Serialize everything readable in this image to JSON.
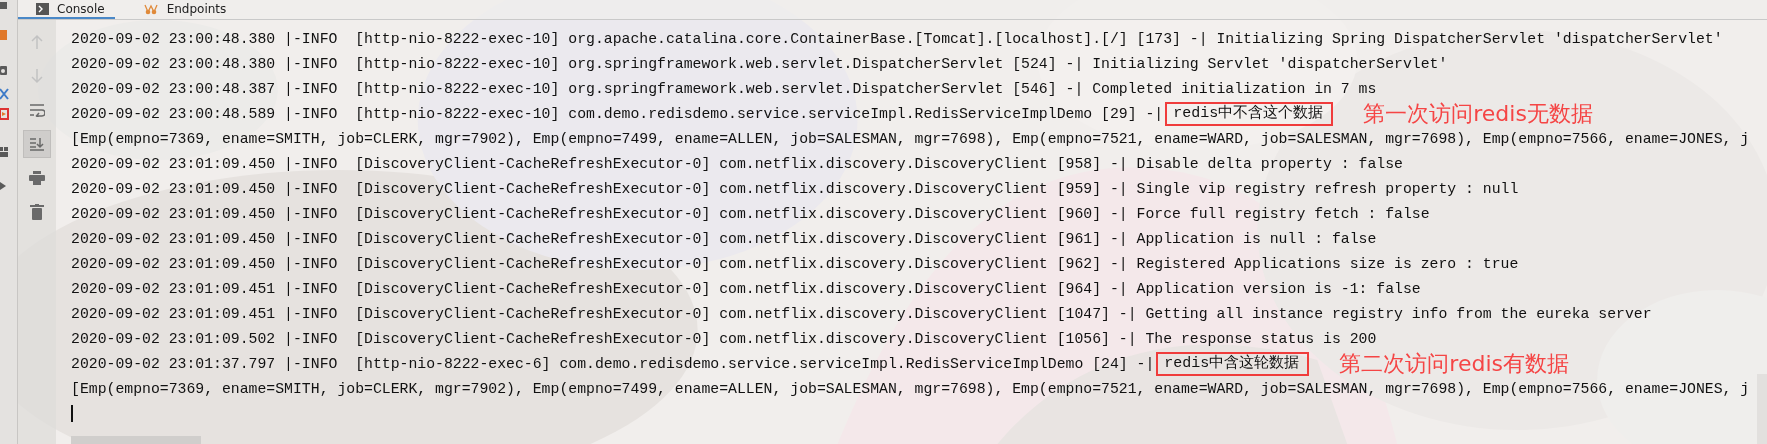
{
  "tabs": [
    {
      "label": "Console",
      "kind": "console",
      "selected": true
    },
    {
      "label": "Endpoints",
      "kind": "endpoints",
      "selected": false
    }
  ],
  "toolbar": [
    {
      "kind": "up",
      "disabled": true,
      "selected": false
    },
    {
      "kind": "down",
      "disabled": true,
      "selected": false
    },
    {
      "kind": "wrap",
      "disabled": false,
      "selected": false
    },
    {
      "kind": "scroll-end",
      "disabled": false,
      "selected": true
    },
    {
      "kind": "print",
      "disabled": false,
      "selected": false
    },
    {
      "kind": "trash",
      "disabled": false,
      "selected": false
    }
  ],
  "lines": [
    {
      "text": "2020-09-02 23:00:48.380 |-INFO  [http-nio-8222-exec-10] org.apache.catalina.core.ContainerBase.[Tomcat].[localhost].[/] [173] -| Initializing Spring DispatcherServlet 'dispatcherServlet'"
    },
    {
      "text": "2020-09-02 23:00:48.380 |-INFO  [http-nio-8222-exec-10] org.springframework.web.servlet.DispatcherServlet [524] -| Initializing Servlet 'dispatcherServlet'"
    },
    {
      "text": "2020-09-02 23:00:48.387 |-INFO  [http-nio-8222-exec-10] org.springframework.web.servlet.DispatcherServlet [546] -| Completed initialization in 7 ms"
    },
    {
      "text": "2020-09-02 23:00:48.589 |-INFO  [http-nio-8222-exec-10] com.demo.redisdemo.service.serviceImpl.RedisServiceImplDemo [29] -|",
      "highlight": "redis中不含这个数据",
      "annotation": "第一次访问redis无数据"
    },
    {
      "text": "[Emp(empno=7369, ename=SMITH, job=CLERK, mgr=7902), Emp(empno=7499, ename=ALLEN, job=SALESMAN, mgr=7698), Emp(empno=7521, ename=WARD, job=SALESMAN, mgr=7698), Emp(empno=7566, ename=JONES, j"
    },
    {
      "text": "2020-09-02 23:01:09.450 |-INFO  [DiscoveryClient-CacheRefreshExecutor-0] com.netflix.discovery.DiscoveryClient [958] -| Disable delta property : false"
    },
    {
      "text": "2020-09-02 23:01:09.450 |-INFO  [DiscoveryClient-CacheRefreshExecutor-0] com.netflix.discovery.DiscoveryClient [959] -| Single vip registry refresh property : null"
    },
    {
      "text": "2020-09-02 23:01:09.450 |-INFO  [DiscoveryClient-CacheRefreshExecutor-0] com.netflix.discovery.DiscoveryClient [960] -| Force full registry fetch : false"
    },
    {
      "text": "2020-09-02 23:01:09.450 |-INFO  [DiscoveryClient-CacheRefreshExecutor-0] com.netflix.discovery.DiscoveryClient [961] -| Application is null : false"
    },
    {
      "text": "2020-09-02 23:01:09.450 |-INFO  [DiscoveryClient-CacheRefreshExecutor-0] com.netflix.discovery.DiscoveryClient [962] -| Registered Applications size is zero : true"
    },
    {
      "text": "2020-09-02 23:01:09.451 |-INFO  [DiscoveryClient-CacheRefreshExecutor-0] com.netflix.discovery.DiscoveryClient [964] -| Application version is -1: false"
    },
    {
      "text": "2020-09-02 23:01:09.451 |-INFO  [DiscoveryClient-CacheRefreshExecutor-0] com.netflix.discovery.DiscoveryClient [1047] -| Getting all instance registry info from the eureka server"
    },
    {
      "text": "2020-09-02 23:01:09.502 |-INFO  [DiscoveryClient-CacheRefreshExecutor-0] com.netflix.discovery.DiscoveryClient [1056] -| The response status is 200"
    },
    {
      "text": "2020-09-02 23:01:37.797 |-INFO  [http-nio-8222-exec-6] com.demo.redisdemo.service.serviceImpl.RedisServiceImplDemo [24] -|",
      "highlight": "redis中含这轮数据",
      "annotation": "第二次访问redis有数据"
    },
    {
      "text": "[Emp(empno=7369, ename=SMITH, job=CLERK, mgr=7902), Emp(empno=7499, ename=ALLEN, job=SALESMAN, mgr=7698), Emp(empno=7521, ename=WARD, job=SALESMAN, mgr=7698), Emp(empno=7566, ename=JONES, j"
    }
  ]
}
